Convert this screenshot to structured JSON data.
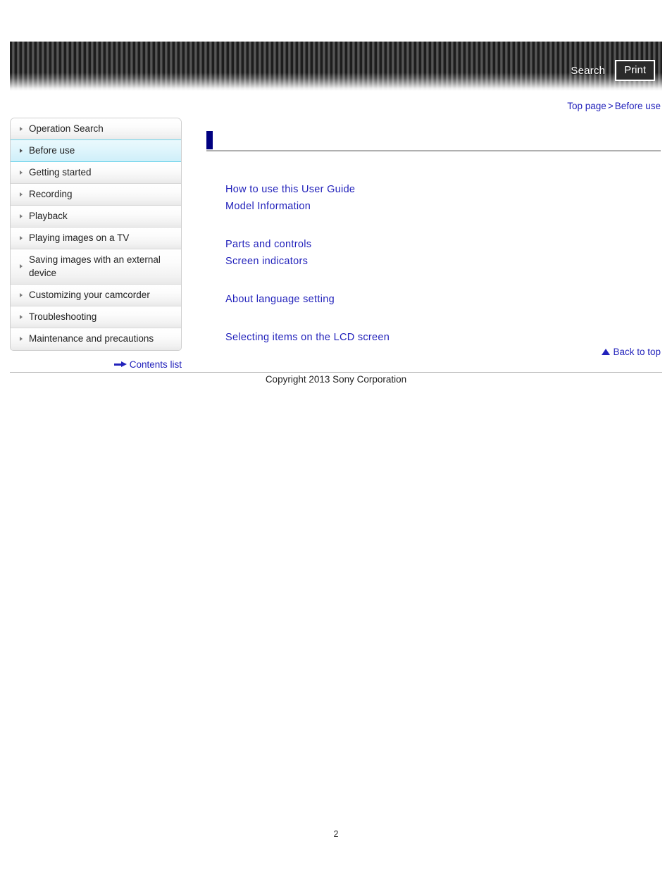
{
  "header": {
    "search_label": "Search",
    "print_label": "Print"
  },
  "breadcrumb": {
    "top_page": "Top page",
    "separator": ">",
    "current": "Before use"
  },
  "sidebar": {
    "items": [
      {
        "label": "Operation Search",
        "selected": false
      },
      {
        "label": "Before use",
        "selected": true
      },
      {
        "label": "Getting started",
        "selected": false
      },
      {
        "label": "Recording",
        "selected": false
      },
      {
        "label": "Playback",
        "selected": false
      },
      {
        "label": "Playing images on a TV",
        "selected": false
      },
      {
        "label": "Saving images with an external device",
        "selected": false
      },
      {
        "label": "Customizing your camcorder",
        "selected": false
      },
      {
        "label": "Troubleshooting",
        "selected": false
      },
      {
        "label": "Maintenance and precautions",
        "selected": false
      }
    ],
    "contents_list_label": "Contents list"
  },
  "main": {
    "heading": "",
    "link_groups": [
      [
        "How to use this User Guide",
        "Model Information"
      ],
      [
        "Parts and controls",
        "Screen indicators"
      ],
      [
        "About language setting"
      ],
      [
        "Selecting items on the LCD screen"
      ]
    ],
    "back_to_top_label": "Back to top"
  },
  "footer": {
    "copyright": "Copyright 2013 Sony Corporation",
    "page_number": "2"
  },
  "colors": {
    "link": "#2222bb",
    "heading_marker": "#000080",
    "selected_item": "#cfeff9"
  }
}
